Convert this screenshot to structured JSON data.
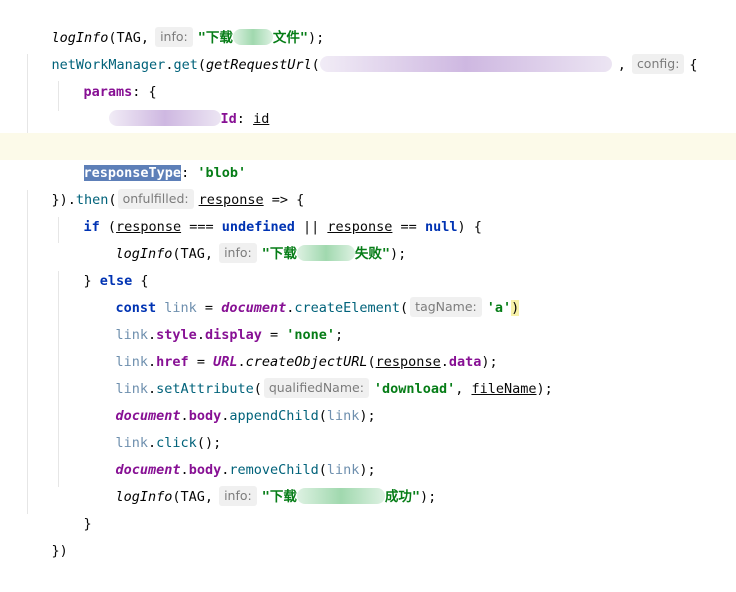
{
  "code": {
    "l1": {
      "fn": "logInfo",
      "open": "(TAG,",
      "hint": "info:",
      "str_a": "\"下载",
      "str_b": "文件\"",
      "close": ");"
    },
    "l2": {
      "obj": "netWorkManager",
      "dot": ".",
      "method": "get",
      "fn": "getRequestUrl",
      "comma": ",",
      "hint": "config:",
      "brace": "{"
    },
    "l3": {
      "prop": "params",
      "rest": ": {"
    },
    "l4": {
      "key_tail": "Id",
      "colon": ":",
      "value": "id"
    },
    "l5": {
      "text": "},"
    },
    "l6": {
      "key": "responseType",
      "colon": ":",
      "value": "'blob'"
    },
    "l7": {
      "prefix": "}).",
      "method": "then",
      "paren": "(",
      "hint": "onfulfilled:",
      "param": "response",
      "arrow": " => {"
    },
    "l8": {
      "kw": "if",
      "open": " (",
      "p1": "response",
      "op1": " === ",
      "u": "undefined",
      "op2": " || ",
      "p2": "response",
      "op3": " == ",
      "nul": "null",
      "close": ") {"
    },
    "l9": {
      "fn": "logInfo",
      "open": "(TAG,",
      "hint": "info:",
      "str_a": "\"下载",
      "str_b": "失败\"",
      "close": ");"
    },
    "l10": {
      "brace": "} ",
      "kw": "else",
      "rest": " {"
    },
    "l11": {
      "kw": "const",
      "var": " link",
      "eq": " = ",
      "glob": "document",
      "dot": ".",
      "method": "createElement",
      "paren": "(",
      "hint": "tagName:",
      "str": "'a'",
      "close": ")"
    },
    "l12": {
      "var": "link",
      "dot1": ".",
      "p1": "style",
      "dot2": ".",
      "p2": "display",
      "eq": " = ",
      "str": "'none'",
      "semi": ";"
    },
    "l13": {
      "var": "link",
      "dot1": ".",
      "p1": "href",
      "eq": " = ",
      "glob": "URL",
      "dot2": ".",
      "fn": "createObjectURL",
      "open": "(",
      "p2": "response",
      "dot3": ".",
      "p3": "data",
      "close": ");"
    },
    "l14": {
      "var": "link",
      "dot": ".",
      "method": "setAttribute",
      "paren": "(",
      "hint": "qualifiedName:",
      "str": "'download'",
      "comma": ", ",
      "arg": "fileName",
      "close": ");"
    },
    "l15": {
      "glob": "document",
      "dot1": ".",
      "p1": "body",
      "dot2": ".",
      "method": "appendChild",
      "open": "(",
      "arg": "link",
      "close": ");"
    },
    "l16": {
      "var": "link",
      "dot": ".",
      "method": "click",
      "rest": "();"
    },
    "l17": {
      "glob": "document",
      "dot1": ".",
      "p1": "body",
      "dot2": ".",
      "method": "removeChild",
      "open": "(",
      "arg": "link",
      "close": ");"
    },
    "l18": {
      "fn": "logInfo",
      "open": "(TAG,",
      "hint": "info:",
      "str_a": "\"下载",
      "str_b": "成功\"",
      "close": ");"
    },
    "l19": {
      "text": "}"
    },
    "l20": {
      "text": "})"
    }
  }
}
